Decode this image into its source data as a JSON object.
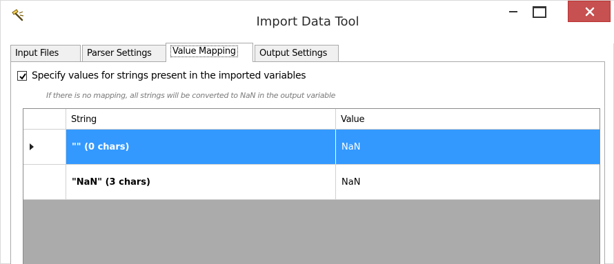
{
  "window": {
    "title": "Import Data Tool",
    "icon": "wand-icon"
  },
  "tabs": [
    {
      "label": "Input Files",
      "active": false
    },
    {
      "label": "Parser Settings",
      "active": false
    },
    {
      "label": "Value Mapping",
      "active": true
    },
    {
      "label": "Output Settings",
      "active": false
    }
  ],
  "value_mapping": {
    "specify_checkbox": {
      "label": "Specify values for strings present in the imported variables",
      "checked": true
    },
    "hint": "If there is no mapping, all strings will be converted to NaN in the output variable",
    "grid": {
      "columns": [
        "String",
        "Value"
      ],
      "rows": [
        {
          "string": "\"\" (0 chars)",
          "value": "NaN",
          "selected": true
        },
        {
          "string": "\"NaN\" (3 chars)",
          "value": "NaN",
          "selected": false
        }
      ]
    }
  },
  "colors": {
    "selection": "#3399ff",
    "close_button": "#c75050",
    "grid_background": "#ababab"
  }
}
